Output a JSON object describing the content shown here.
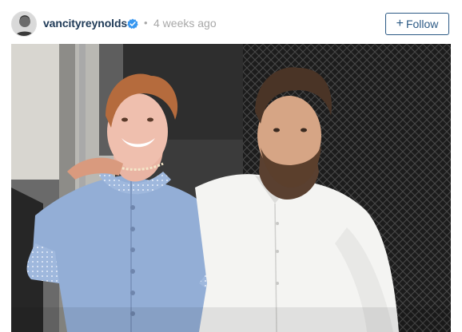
{
  "post": {
    "username": "vancityreynolds",
    "separator": "•",
    "timestamp": "4 weeks ago",
    "follow_label": "Follow",
    "follow_symbol": "+"
  },
  "icons": {
    "verified": "verified-badge-icon",
    "avatar": "profile-avatar"
  },
  "colors": {
    "username": "#1f3a57",
    "verified": "#3897f0",
    "follow_border": "#2c5a85",
    "muted_text": "#a8a8a8"
  }
}
